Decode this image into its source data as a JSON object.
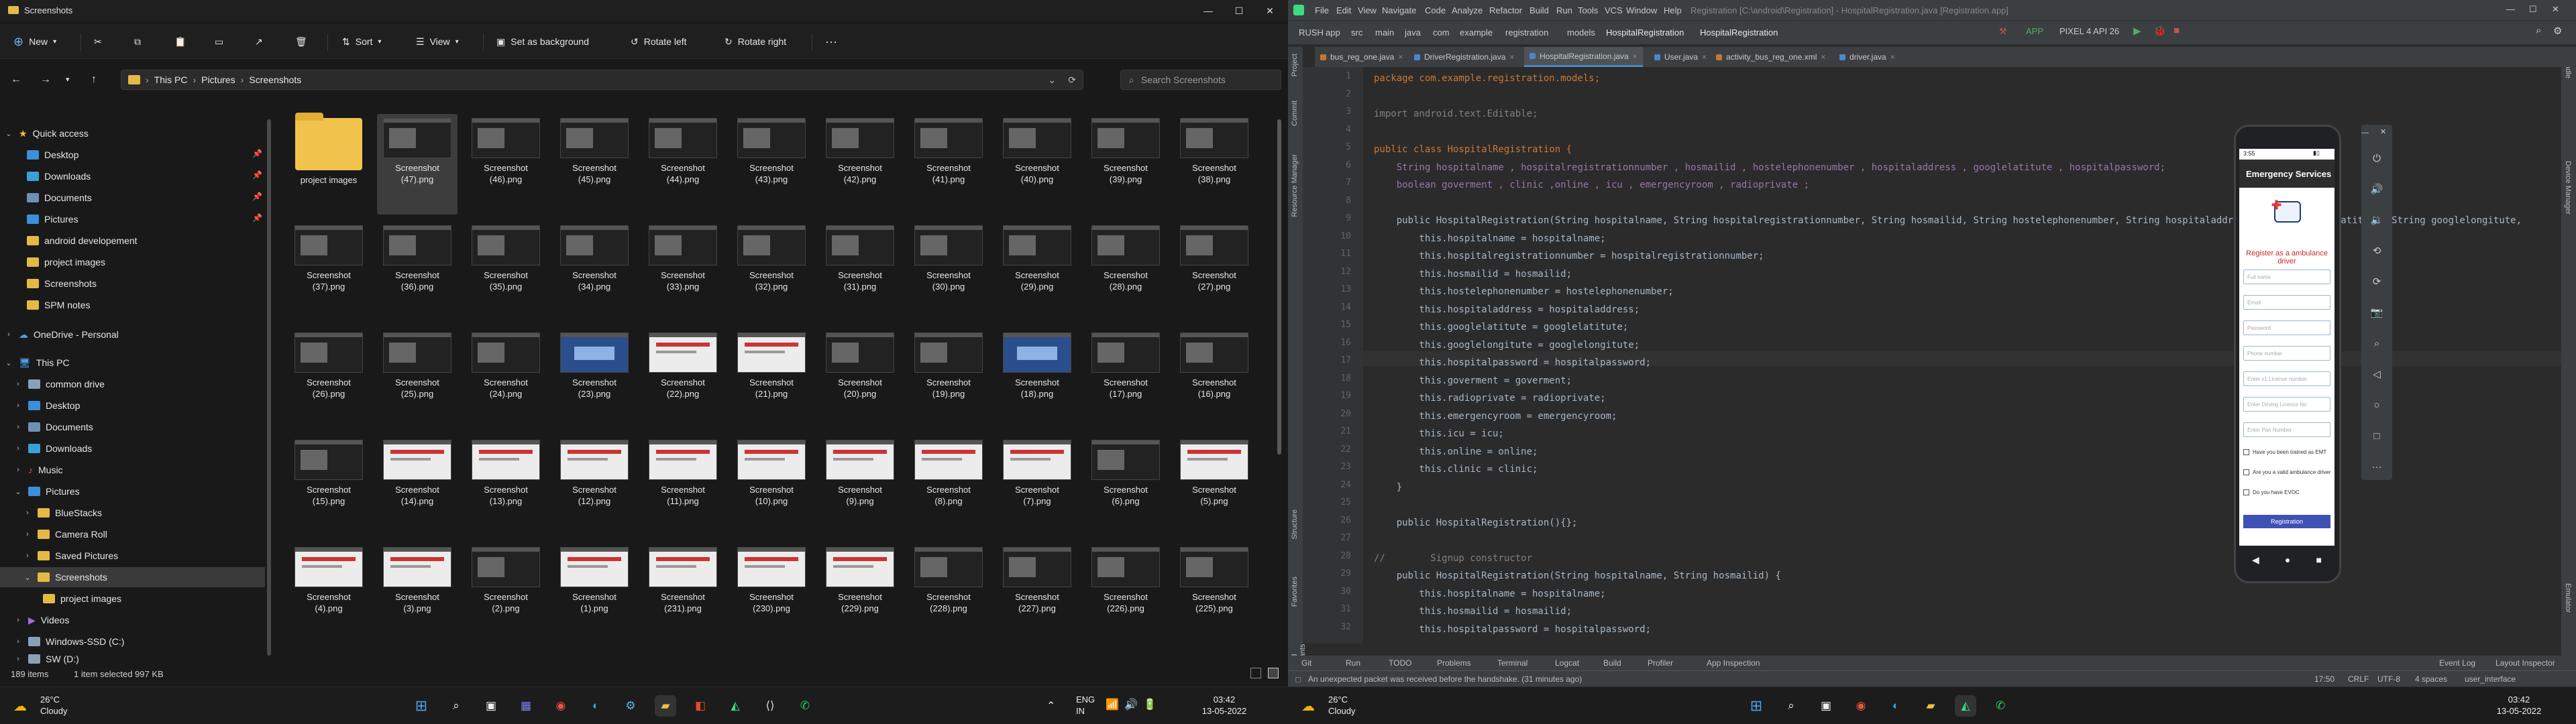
{
  "explorer": {
    "title": "Screenshots",
    "window_controls": [
      "—",
      "☐",
      "✕"
    ],
    "ribbon": {
      "new": "New",
      "sort": "Sort",
      "view": "View",
      "set_background": "Set as background",
      "rotate_left": "Rotate left",
      "rotate_right": "Rotate right",
      "more": "···"
    },
    "address": {
      "path": [
        "This PC",
        "Pictures",
        "Screenshots"
      ],
      "search_placeholder": "Search Screenshots"
    },
    "nav": [
      {
        "label": "Quick access",
        "icon": "star-icon"
      },
      {
        "label": "Desktop",
        "pinned": true
      },
      {
        "label": "Downloads",
        "pinned": true
      },
      {
        "label": "Documents",
        "pinned": true
      },
      {
        "label": "Pictures",
        "pinned": true
      },
      {
        "label": "android developement"
      },
      {
        "label": "project images"
      },
      {
        "label": "Screenshots"
      },
      {
        "label": "SPM notes"
      },
      {
        "label": "OneDrive - Personal"
      },
      {
        "label": "This PC"
      },
      {
        "label": "common drive"
      },
      {
        "label": "Desktop"
      },
      {
        "label": "Documents"
      },
      {
        "label": "Downloads"
      },
      {
        "label": "Music"
      },
      {
        "label": "Pictures"
      },
      {
        "label": "BlueStacks"
      },
      {
        "label": "Camera Roll"
      },
      {
        "label": "Saved Pictures"
      },
      {
        "label": "Screenshots"
      },
      {
        "label": "project images"
      },
      {
        "label": "Videos"
      },
      {
        "label": "Windows-SSD (C:)"
      },
      {
        "label": "SW (D:)"
      }
    ],
    "files": [
      {
        "l1": "project images",
        "l2": "",
        "kind": "folder"
      },
      {
        "l1": "Screenshot",
        "l2": "(47).png",
        "kind": "dark"
      },
      {
        "l1": "Screenshot",
        "l2": "(46).png",
        "kind": "dark"
      },
      {
        "l1": "Screenshot",
        "l2": "(45).png",
        "kind": "dark"
      },
      {
        "l1": "Screenshot",
        "l2": "(44).png",
        "kind": "dark"
      },
      {
        "l1": "Screenshot",
        "l2": "(43).png",
        "kind": "dark"
      },
      {
        "l1": "Screenshot",
        "l2": "(42).png",
        "kind": "dark"
      },
      {
        "l1": "Screenshot",
        "l2": "(41).png",
        "kind": "dark"
      },
      {
        "l1": "Screenshot",
        "l2": "(40).png",
        "kind": "dark"
      },
      {
        "l1": "Screenshot",
        "l2": "(39).png",
        "kind": "dark"
      },
      {
        "l1": "Screenshot",
        "l2": "(38).png",
        "kind": "dark"
      },
      {
        "l1": "Screenshot",
        "l2": "(37).png",
        "kind": "dark"
      },
      {
        "l1": "Screenshot",
        "l2": "(36).png",
        "kind": "dark"
      },
      {
        "l1": "Screenshot",
        "l2": "(35).png",
        "kind": "dark"
      },
      {
        "l1": "Screenshot",
        "l2": "(34).png",
        "kind": "dark"
      },
      {
        "l1": "Screenshot",
        "l2": "(33).png",
        "kind": "dark"
      },
      {
        "l1": "Screenshot",
        "l2": "(32).png",
        "kind": "dark"
      },
      {
        "l1": "Screenshot",
        "l2": "(31).png",
        "kind": "dark"
      },
      {
        "l1": "Screenshot",
        "l2": "(30).png",
        "kind": "dark"
      },
      {
        "l1": "Screenshot",
        "l2": "(29).png",
        "kind": "dark"
      },
      {
        "l1": "Screenshot",
        "l2": "(28).png",
        "kind": "dark"
      },
      {
        "l1": "Screenshot",
        "l2": "(27).png",
        "kind": "dark"
      },
      {
        "l1": "Screenshot",
        "l2": "(26).png",
        "kind": "dark"
      },
      {
        "l1": "Screenshot",
        "l2": "(25).png",
        "kind": "dark"
      },
      {
        "l1": "Screenshot",
        "l2": "(24).png",
        "kind": "dark"
      },
      {
        "l1": "Screenshot",
        "l2": "(23).png",
        "kind": "blue"
      },
      {
        "l1": "Screenshot",
        "l2": "(22).png",
        "kind": "light"
      },
      {
        "l1": "Screenshot",
        "l2": "(21).png",
        "kind": "light"
      },
      {
        "l1": "Screenshot",
        "l2": "(20).png",
        "kind": "dark"
      },
      {
        "l1": "Screenshot",
        "l2": "(19).png",
        "kind": "dark"
      },
      {
        "l1": "Screenshot",
        "l2": "(18).png",
        "kind": "blue"
      },
      {
        "l1": "Screenshot",
        "l2": "(17).png",
        "kind": "dark"
      },
      {
        "l1": "Screenshot",
        "l2": "(16).png",
        "kind": "dark"
      },
      {
        "l1": "Screenshot",
        "l2": "(15).png",
        "kind": "dark"
      },
      {
        "l1": "Screenshot",
        "l2": "(14).png",
        "kind": "light"
      },
      {
        "l1": "Screenshot",
        "l2": "(13).png",
        "kind": "light"
      },
      {
        "l1": "Screenshot",
        "l2": "(12).png",
        "kind": "light"
      },
      {
        "l1": "Screenshot",
        "l2": "(11).png",
        "kind": "light"
      },
      {
        "l1": "Screenshot",
        "l2": "(10).png",
        "kind": "light"
      },
      {
        "l1": "Screenshot",
        "l2": "(9).png",
        "kind": "light"
      },
      {
        "l1": "Screenshot",
        "l2": "(8).png",
        "kind": "light"
      },
      {
        "l1": "Screenshot",
        "l2": "(7).png",
        "kind": "light"
      },
      {
        "l1": "Screenshot",
        "l2": "(6).png",
        "kind": "dark"
      },
      {
        "l1": "Screenshot",
        "l2": "(5).png",
        "kind": "light"
      },
      {
        "l1": "Screenshot",
        "l2": "(4).png",
        "kind": "light"
      },
      {
        "l1": "Screenshot",
        "l2": "(3).png",
        "kind": "light"
      },
      {
        "l1": "Screenshot",
        "l2": "(2).png",
        "kind": "dark"
      },
      {
        "l1": "Screenshot",
        "l2": "(1).png",
        "kind": "light"
      },
      {
        "l1": "Screenshot",
        "l2": "(231).png",
        "kind": "light"
      },
      {
        "l1": "Screenshot",
        "l2": "(230).png",
        "kind": "light"
      },
      {
        "l1": "Screenshot",
        "l2": "(229).png",
        "kind": "light"
      },
      {
        "l1": "Screenshot",
        "l2": "(228).png",
        "kind": "dark"
      },
      {
        "l1": "Screenshot",
        "l2": "(227).png",
        "kind": "dark"
      },
      {
        "l1": "Screenshot",
        "l2": "(226).png",
        "kind": "dark"
      },
      {
        "l1": "Screenshot",
        "l2": "(225).png",
        "kind": "dark"
      }
    ],
    "status": {
      "items": "189 items",
      "selected": "1 item selected  997 KB"
    }
  },
  "studio": {
    "menus": [
      "File",
      "Edit",
      "View",
      "Navigate",
      "Code",
      "Analyze",
      "Refactor",
      "Build",
      "Run",
      "Tools",
      "VCS",
      "Window",
      "Help"
    ],
    "window_title": "Registration [C:\\android\\Registration] - HospitalRegistration.java [Registration.app]",
    "breadcrumbs": [
      "RUSH",
      "app",
      "src",
      "main",
      "java",
      "com",
      "example",
      "registration",
      "models",
      "HospitalRegistration",
      "HospitalRegistration"
    ],
    "run_config": "APP",
    "device": "PIXEL 4 API 26",
    "tabs": [
      {
        "label": "bus_reg_one.java",
        "color": "#c57633"
      },
      {
        "label": "DriverRegistration.java",
        "color": "#4a88c7"
      },
      {
        "label": "HospitalRegistration.java",
        "color": "#4a88c7",
        "active": true
      },
      {
        "label": "User.java",
        "color": "#4a88c7"
      },
      {
        "label": "activity_bus_reg_one.xml",
        "color": "#c57633"
      },
      {
        "label": "driver.java",
        "color": "#4a88c7"
      }
    ],
    "code_lines": [
      {
        "n": "1",
        "t": "package com.example.registration.models;",
        "cls": "kw"
      },
      {
        "n": "2",
        "t": "",
        "cls": "tx"
      },
      {
        "n": "3",
        "t": "import android.text.Editable;",
        "cls": "cm"
      },
      {
        "n": "4",
        "t": "",
        "cls": "tx"
      },
      {
        "n": "5",
        "t": "public class HospitalRegistration {",
        "cls": "kw"
      },
      {
        "n": "6",
        "t": "    String hospitalname , hospitalregistrationnumber , hosmailid , hostelephonenumber , hospitaladdress , googlelatitute , hospitalpassword;",
        "cls": "fld"
      },
      {
        "n": "7",
        "t": "    boolean goverment , clinic ,online , icu , emergencyroom , radioprivate ;",
        "cls": "fld"
      },
      {
        "n": "8",
        "t": "",
        "cls": "tx"
      },
      {
        "n": "9",
        "t": "    public HospitalRegistration(String hospitalname, String hospitalregistrationnumber, String hosmailid, String hostelephonenumber, String hospitaladdress, String googlelatitute, String googlelongitute,",
        "cls": "tx"
      },
      {
        "n": "10",
        "t": "        this.hospitalname = hospitalname;",
        "cls": "tx"
      },
      {
        "n": "11",
        "t": "        this.hospitalregistrationnumber = hospitalregistrationnumber;",
        "cls": "tx"
      },
      {
        "n": "12",
        "t": "        this.hosmailid = hosmailid;",
        "cls": "tx"
      },
      {
        "n": "13",
        "t": "        this.hostelephonenumber = hostelephonenumber;",
        "cls": "tx"
      },
      {
        "n": "14",
        "t": "        this.hospitaladdress = hospitaladdress;",
        "cls": "tx"
      },
      {
        "n": "15",
        "t": "        this.googlelatitute = googlelatitute;",
        "cls": "tx"
      },
      {
        "n": "16",
        "t": "        this.googlelongitute = googlelongitute;",
        "cls": "tx"
      },
      {
        "n": "17",
        "t": "        this.hospitalpassword = hospitalpassword;",
        "cls": "tx"
      },
      {
        "n": "18",
        "t": "        this.goverment = goverment;",
        "cls": "tx"
      },
      {
        "n": "19",
        "t": "        this.radioprivate = radioprivate;",
        "cls": "tx"
      },
      {
        "n": "20",
        "t": "        this.emergencyroom = emergencyroom;",
        "cls": "tx"
      },
      {
        "n": "21",
        "t": "        this.icu = icu;",
        "cls": "tx"
      },
      {
        "n": "22",
        "t": "        this.online = online;",
        "cls": "tx"
      },
      {
        "n": "23",
        "t": "        this.clinic = clinic;",
        "cls": "tx"
      },
      {
        "n": "24",
        "t": "    }",
        "cls": "tx"
      },
      {
        "n": "25",
        "t": "",
        "cls": "tx"
      },
      {
        "n": "26",
        "t": "    public HospitalRegistration(){};",
        "cls": "tx"
      },
      {
        "n": "27",
        "t": "",
        "cls": "tx"
      },
      {
        "n": "28",
        "t": "//        Signup constructor",
        "cls": "cm"
      },
      {
        "n": "29",
        "t": "    public HospitalRegistration(String hospitalname, String hosmailid) {",
        "cls": "tx"
      },
      {
        "n": "30",
        "t": "        this.hospitalname = hospitalname;",
        "cls": "tx"
      },
      {
        "n": "31",
        "t": "        this.hosmailid = hosmailid;",
        "cls": "tx"
      },
      {
        "n": "32",
        "t": "        this.hospitalpassword = hospitalpassword;",
        "cls": "tx"
      }
    ],
    "emulator": {
      "app_title": "Emergency Services",
      "heading": "Register as a ambulance driver",
      "fields": [
        "Full name",
        "Email",
        "Password",
        "Phone number",
        "Enter x1 License number",
        "Enter Driving Licence No",
        "Enter Pan Number"
      ],
      "checks": [
        "Have you been trained as EMT",
        "Are you a valid ambulance driver",
        "Do you have EVOC"
      ],
      "button": "Registration",
      "time": "3:55"
    },
    "bottom_tools": [
      "Git",
      "Run",
      "TODO",
      "Problems",
      "Terminal",
      "Logcat",
      "Build",
      "Profiler",
      "App Inspection",
      "Event Log",
      "Layout Inspector"
    ],
    "status_message": "An unexpected packet was received before the handshake. (31 minutes ago)",
    "status_right": [
      "17:50",
      "CRLF",
      "UTF-8",
      "4 spaces",
      "user_interface"
    ]
  },
  "taskbar_left": {
    "temp": "26°C",
    "weather": "Cloudy",
    "lang1": "ENG",
    "lang2": "IN",
    "time": "03:42",
    "date": "13-05-2022"
  },
  "taskbar_right": {
    "temp": "26°C",
    "weather": "Cloudy",
    "time": "03:42",
    "date": "13-05-2022"
  }
}
